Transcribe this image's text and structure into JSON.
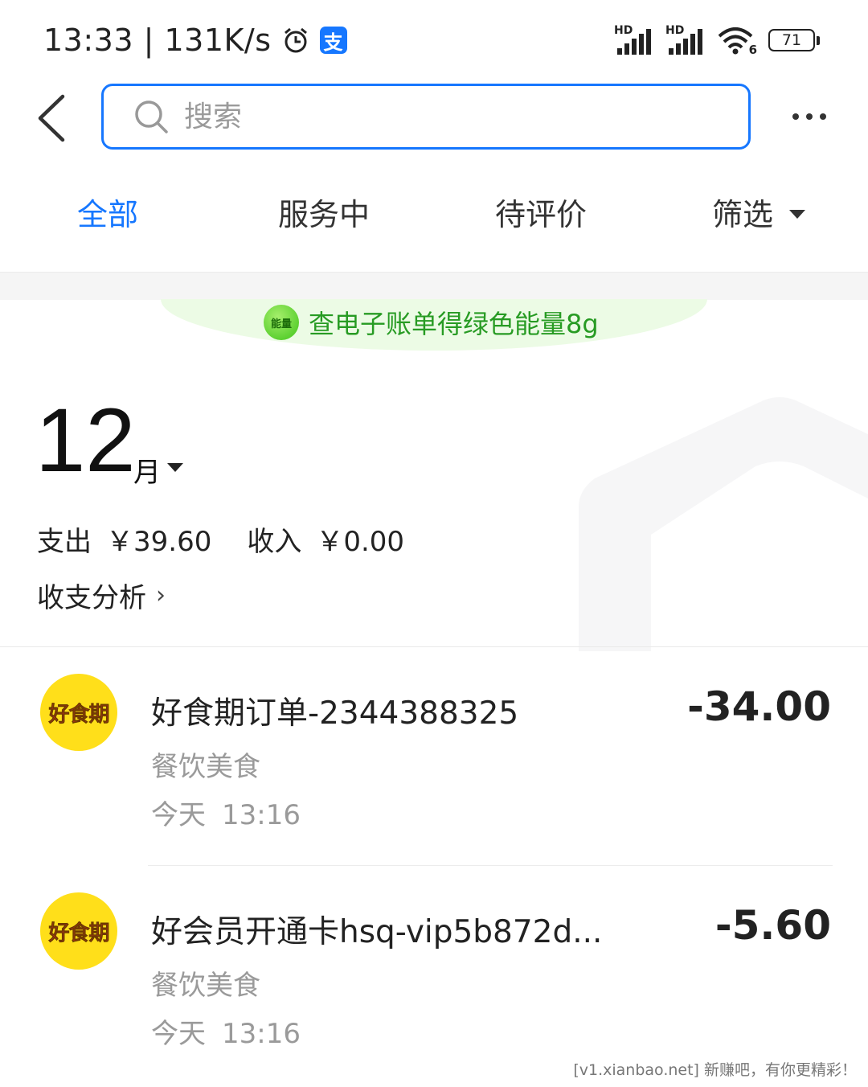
{
  "status_bar": {
    "time": "13:33 | 131K/s",
    "app_badge": "支",
    "network_label_1": "HD",
    "network_label_2": "HD",
    "wifi_label": "6",
    "battery": "71"
  },
  "search": {
    "placeholder": "搜索",
    "value": ""
  },
  "tabs": [
    {
      "label": "全部",
      "active": true
    },
    {
      "label": "服务中",
      "active": false
    },
    {
      "label": "待评价",
      "active": false
    }
  ],
  "filter_label": "筛选",
  "energy_banner": {
    "icon_label": "能量",
    "text": "查电子账单得绿色能量8g"
  },
  "month": {
    "number": "12",
    "suffix": "月"
  },
  "summary": {
    "expense_label": "支出",
    "expense_value": "￥39.60",
    "income_label": "收入",
    "income_value": "￥0.00"
  },
  "analysis_link": "收支分析",
  "transactions": [
    {
      "merchant_logo": "好食期",
      "title": "好食期订单-2344388325",
      "amount": "-34.00",
      "category": "餐饮美食",
      "day": "今天",
      "time": "13:16"
    },
    {
      "merchant_logo": "好食期",
      "title": "好会员开通卡hsq-vip5b872d...",
      "amount": "-5.60",
      "category": "餐饮美食",
      "day": "今天",
      "time": "13:16"
    }
  ],
  "footer_watermark": "[v1.xianbao.net] 新赚吧，有你更精彩！",
  "colors": {
    "accent": "#1677ff",
    "energy_green": "#279b23",
    "merchant_yellow": "#ffdf1a"
  }
}
